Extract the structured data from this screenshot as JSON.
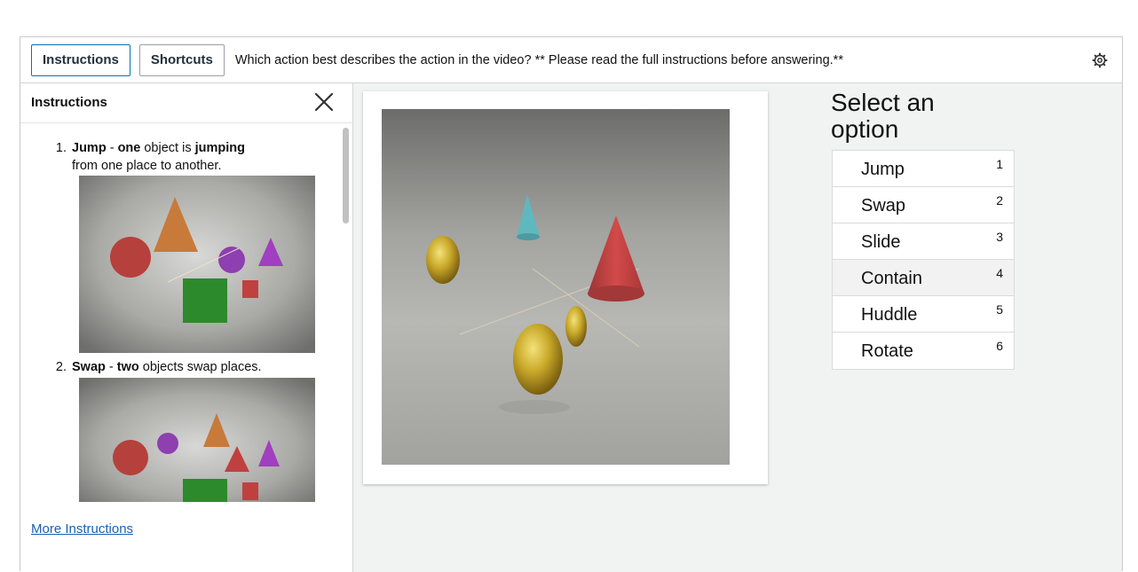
{
  "toolbar": {
    "instructions_label": "Instructions",
    "shortcuts_label": "Shortcuts",
    "question": "Which action best describes the action in the video? ** Please read the full instructions before answering.**"
  },
  "sidebar": {
    "title": "Instructions",
    "items": [
      {
        "num": "1.",
        "bold1": "Jump",
        "t1": " - ",
        "bold2": "one",
        "t2": " object is ",
        "bold3": "jumping",
        "t3": " from one place to another."
      },
      {
        "num": "2.",
        "bold1": "Swap",
        "t1": " - ",
        "bold2": "two",
        "t2": " objects swap places.",
        "bold3": "",
        "t3": ""
      }
    ],
    "more_link": "More Instructions"
  },
  "options_panel": {
    "title": "Select an option",
    "options": [
      {
        "label": "Jump",
        "key": "1"
      },
      {
        "label": "Swap",
        "key": "2"
      },
      {
        "label": "Slide",
        "key": "3"
      },
      {
        "label": "Contain",
        "key": "4"
      },
      {
        "label": "Huddle",
        "key": "5"
      },
      {
        "label": "Rotate",
        "key": "6"
      }
    ],
    "highlighted": "Contain"
  },
  "colors": {
    "accent_border": "#0073bb",
    "link": "#1a5fb4",
    "panel_bg": "#f1f3f3"
  },
  "icons": {
    "settings": "gear-icon",
    "close": "close-icon"
  }
}
